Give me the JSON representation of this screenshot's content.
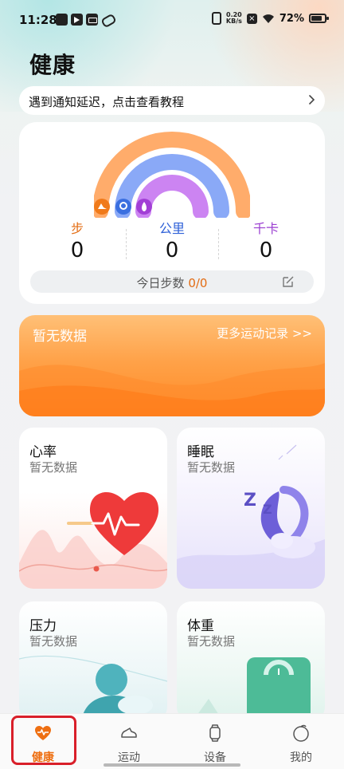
{
  "status_bar": {
    "time": "11:28",
    "net_speed_value": "0.20",
    "net_speed_unit": "KB/s",
    "battery": "72%"
  },
  "page": {
    "title": "健康"
  },
  "notice": {
    "text": "遇到通知延迟，点击查看教程"
  },
  "summary": {
    "steps_label": "步",
    "steps_value": "0",
    "distance_label": "公里",
    "distance_value": "0",
    "calories_label": "千卡",
    "calories_value": "0",
    "today_label": "今日步数",
    "today_value": "0/0",
    "ring_colors": {
      "outer": "#ffac6b",
      "middle": "#8aa9f7",
      "inner": "#cc84f2"
    }
  },
  "sport_card": {
    "no_data": "暂无数据",
    "more_link": "更多运动记录 >>"
  },
  "cards": {
    "heart_rate": {
      "title": "心率",
      "subtitle": "暂无数据"
    },
    "sleep": {
      "title": "睡眠",
      "subtitle": "暂无数据"
    },
    "stress": {
      "title": "压力",
      "subtitle": "暂无数据"
    },
    "weight": {
      "title": "体重",
      "subtitle": "暂无数据"
    }
  },
  "bottom_nav": {
    "items": [
      {
        "label": "健康",
        "icon": "heart-pulse-icon",
        "active": true
      },
      {
        "label": "运动",
        "icon": "sneaker-icon",
        "active": false
      },
      {
        "label": "设备",
        "icon": "watch-icon",
        "active": false
      },
      {
        "label": "我的",
        "icon": "profile-icon",
        "active": false
      }
    ],
    "accent_color": "#ee6f12"
  }
}
